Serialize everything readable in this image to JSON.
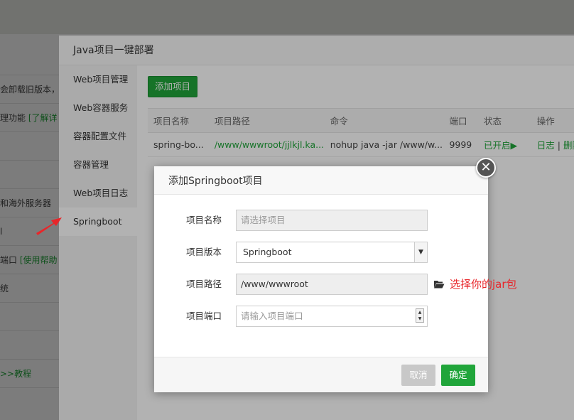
{
  "background_page": {
    "rows": [
      {
        "text": "会卸载旧版本，",
        "link": ""
      },
      {
        "text": "理功能 ",
        "link": "[了解详"
      },
      {
        "text": "",
        "link": ""
      },
      {
        "text": "",
        "link": ""
      },
      {
        "text": "和海外服务器",
        "link": ""
      },
      {
        "text": "l",
        "link": ""
      },
      {
        "text": "端口 ",
        "link": "[使用帮助"
      },
      {
        "text": "统",
        "link": ""
      },
      {
        "text": "",
        "link": ""
      },
      {
        "text": "",
        "link": ""
      },
      {
        "text": "",
        "link": ">>教程"
      }
    ]
  },
  "panel": {
    "title": "Java项目一键部署",
    "sidebar": [
      {
        "label": "Web项目管理"
      },
      {
        "label": "Web容器服务"
      },
      {
        "label": "容器配置文件"
      },
      {
        "label": "容器管理"
      },
      {
        "label": "Web项目日志"
      },
      {
        "label": "Springboot"
      }
    ],
    "add_button": "添加项目",
    "table": {
      "headers": [
        "项目名称",
        "项目路径",
        "命令",
        "端口",
        "状态",
        "操作"
      ],
      "rows": [
        {
          "name": "spring-bo...",
          "path": "/www/wwwroot/jjlkjl.ka...",
          "command": "nohup java -jar /www/w...",
          "port": "9999",
          "status": "已开启▶",
          "action_log": "日志",
          "action_sep": " | ",
          "action_delete": "删除"
        }
      ]
    }
  },
  "modal": {
    "title": "添加Springboot项目",
    "fields": {
      "name": {
        "label": "项目名称",
        "placeholder": "请选择项目"
      },
      "version": {
        "label": "项目版本",
        "value": "Springboot"
      },
      "path": {
        "label": "项目路径",
        "value": "/www/wwwroot"
      },
      "port": {
        "label": "项目端口",
        "placeholder": "请输入项目端口"
      }
    },
    "jar_hint": "选择你的jar包",
    "cancel_label": "取消",
    "ok_label": "确定",
    "close_symbol": "✕"
  },
  "colors": {
    "accent_green": "#20a53a",
    "hint_red": "#e8262a"
  }
}
